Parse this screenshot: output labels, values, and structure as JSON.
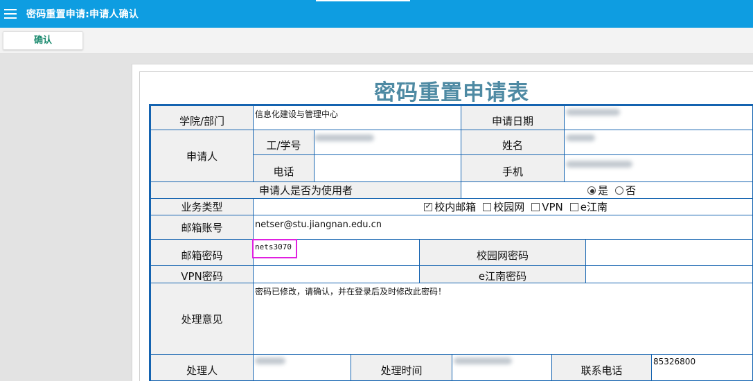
{
  "header": {
    "title": "密码重置申请:申请人确认"
  },
  "toolbar": {
    "confirm_label": "确认"
  },
  "form": {
    "title": "密码重置申请表",
    "labels": {
      "dept": "学院/部门",
      "apply_date": "申请日期",
      "applicant": "申请人",
      "staff_id": "工/学号",
      "name": "姓名",
      "phone": "电话",
      "mobile": "手机",
      "is_user": "申请人是否为使用者",
      "biz_type": "业务类型",
      "mail_account": "邮箱账号",
      "mail_pwd": "邮箱密码",
      "campus_pwd": "校园网密码",
      "vpn_pwd": "VPN密码",
      "ejn_pwd": "e江南密码",
      "opinion": "处理意见",
      "handler": "处理人",
      "handle_time": "处理时间",
      "contact": "联系电话"
    },
    "values": {
      "dept": "信息化建设与管理中心",
      "mail_account": "netser@stu.jiangnan.edu.cn",
      "mail_pwd": "nets3070",
      "opinion": "密码已修改，请确认，并在登录后及时修改此密码！",
      "contact": "85326800"
    },
    "is_user_options": {
      "yes": "是",
      "no": "否",
      "selected": "是"
    },
    "biz_options": [
      {
        "label": "校内邮箱",
        "checked": true
      },
      {
        "label": "校园网",
        "checked": false
      },
      {
        "label": "VPN",
        "checked": false
      },
      {
        "label": "e江南",
        "checked": false
      }
    ]
  },
  "colors": {
    "header_bg": "#0e9de1",
    "border": "#1463b0",
    "title": "#4e8aa3",
    "highlight": "#e020e0"
  }
}
